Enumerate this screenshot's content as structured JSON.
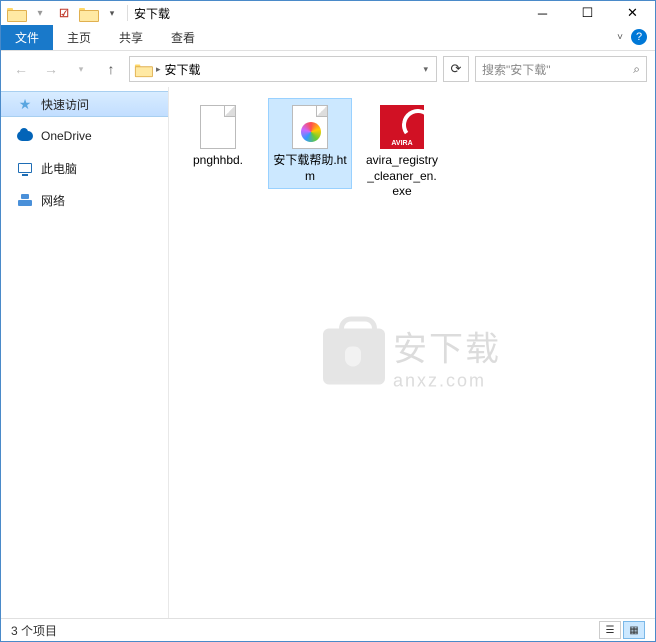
{
  "title": "安下载",
  "ribbon": {
    "file": "文件",
    "home": "主页",
    "share": "共享",
    "view": "查看"
  },
  "breadcrumb": {
    "current": "安下载"
  },
  "search": {
    "placeholder": "搜索\"安下载\""
  },
  "sidebar": {
    "items": [
      {
        "label": "快速访问"
      },
      {
        "label": "OneDrive"
      },
      {
        "label": "此电脑"
      },
      {
        "label": "网络"
      }
    ]
  },
  "files": [
    {
      "name": "pnghhbd."
    },
    {
      "name": "安下载帮助.htm"
    },
    {
      "name": "avira_registry_cleaner_en.exe"
    }
  ],
  "status": {
    "count": "3 个项目"
  },
  "watermark": {
    "cn": "安下载",
    "en": "anxz.com"
  },
  "avira_label": "AVIRA"
}
